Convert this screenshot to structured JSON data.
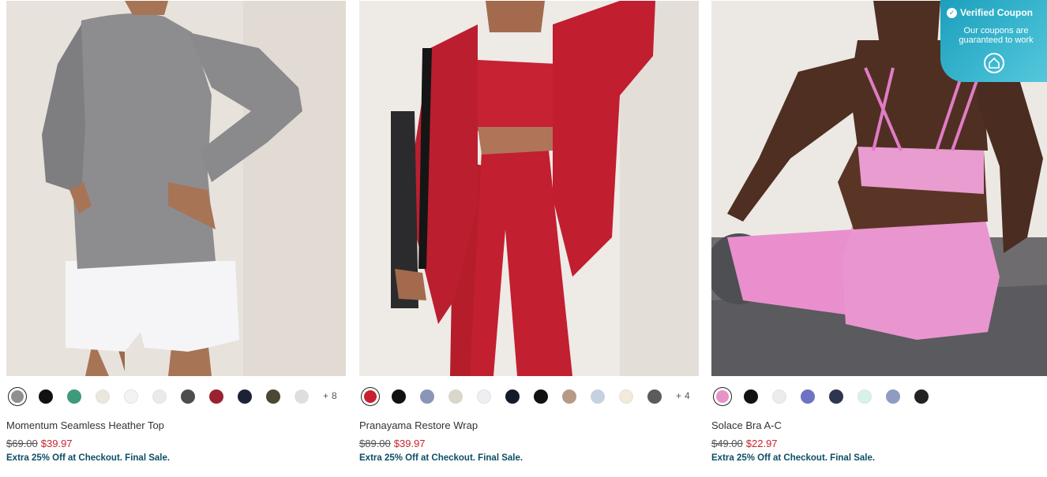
{
  "coupon_badge": {
    "title": "Verified Coupon",
    "body": "Our coupons are guaranteed to work",
    "icon": "shield-home-icon"
  },
  "products": [
    {
      "name": "Momentum Seamless Heather Top",
      "original_price": "$69.00",
      "sale_price": "$39.97",
      "promo": "Extra 25% Off at Checkout. Final Sale.",
      "more_colors": "+ 8",
      "swatches": [
        "#8f8f8f",
        "#111111",
        "#3f9a7c",
        "#ece6dc",
        "#f3f3f5",
        "#e8eaed",
        "#4d4d4d",
        "#9a2230",
        "#1c2235",
        "#4a4734",
        "#dedede"
      ],
      "selected_swatch": 0
    },
    {
      "name": "Pranayama Restore Wrap",
      "original_price": "$89.00",
      "sale_price": "$39.97",
      "promo": "Extra 25% Off at Checkout. Final Sale.",
      "more_colors": "+ 4",
      "swatches": [
        "#c8202f",
        "#111111",
        "#8a96b8",
        "#d9d6cc",
        "#eeeef3",
        "#151a2b",
        "#111111",
        "#b79a86",
        "#c4d2e0",
        "#f3ead9",
        "#5b5b5b"
      ],
      "selected_swatch": 0
    },
    {
      "name": "Solace Bra A-C",
      "original_price": "$49.00",
      "sale_price": "$22.97",
      "promo": "Extra 25% Off at Checkout. Final Sale.",
      "more_colors": "",
      "swatches": [
        "#e693c8",
        "#111111",
        "#ececec",
        "#6e72c4",
        "#2d3550",
        "#d7f2ea",
        "#8d9cc0",
        "#222222"
      ],
      "selected_swatch": 0
    }
  ]
}
